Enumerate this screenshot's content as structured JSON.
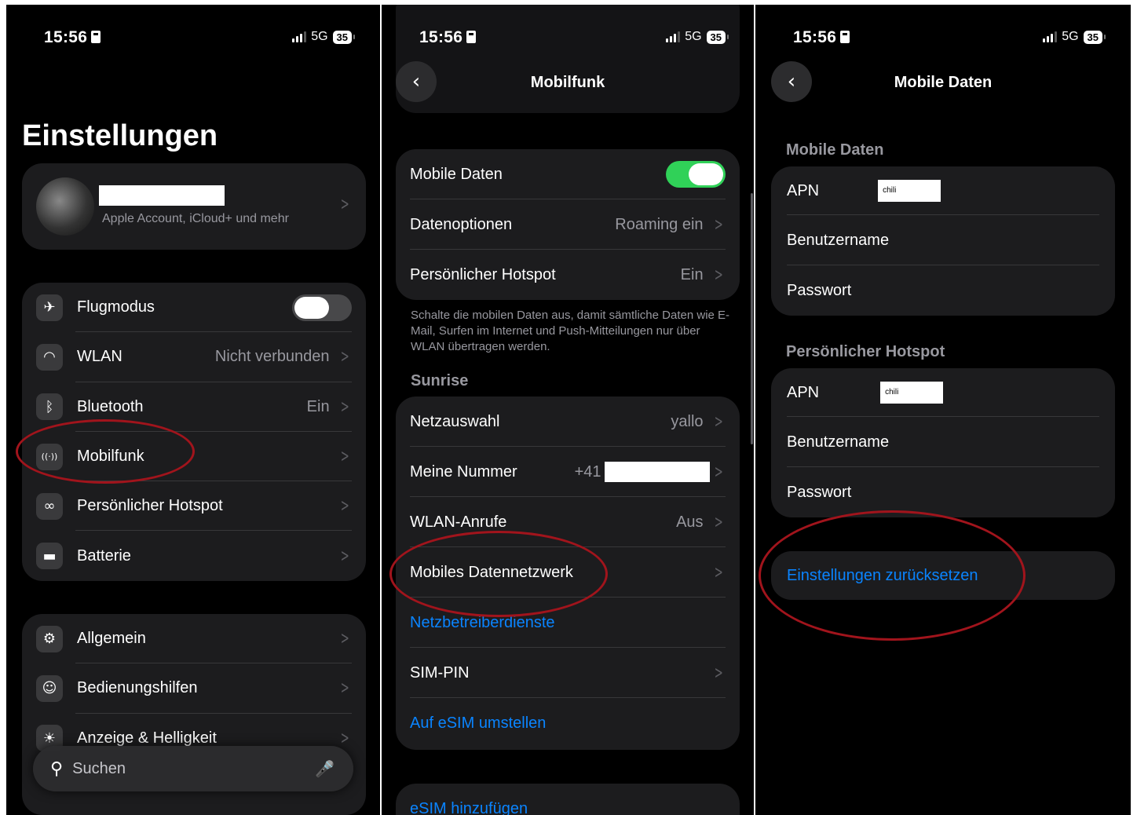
{
  "status": {
    "time": "15:56",
    "network": "5G",
    "battery": "35"
  },
  "panel1": {
    "title": "Einstellungen",
    "account_sub": "Apple Account, iCloud+ und mehr",
    "group1": [
      {
        "label": "Flugmodus",
        "icon": "airplane-icon",
        "toggle": "off"
      },
      {
        "label": "WLAN",
        "value": "Nicht verbunden",
        "icon": "wifi-icon"
      },
      {
        "label": "Bluetooth",
        "value": "Ein",
        "icon": "bluetooth-icon"
      },
      {
        "label": "Mobilfunk",
        "value": "",
        "icon": "antenna-icon"
      },
      {
        "label": "Persönlicher Hotspot",
        "value": "",
        "icon": "hotspot-icon"
      },
      {
        "label": "Batterie",
        "value": "",
        "icon": "battery-icon"
      }
    ],
    "group2": [
      {
        "label": "Allgemein",
        "icon": "gear-icon"
      },
      {
        "label": "Bedienungshilfen",
        "icon": "accessibility-icon"
      },
      {
        "label": "Anzeige & Helligkeit",
        "icon": "brightness-icon"
      }
    ],
    "search_placeholder": "Suchen"
  },
  "panel2": {
    "title": "Mobilfunk",
    "group1": {
      "mobile_data": "Mobile Daten",
      "data_options": "Datenoptionen",
      "data_options_value": "Roaming ein",
      "hotspot": "Persönlicher Hotspot",
      "hotspot_value": "Ein"
    },
    "footnote": "Schalte die mobilen Daten aus, damit sämtliche Daten wie E-Mail, Surfen im Internet und Push-Mitteilungen nur über WLAN übertragen werden.",
    "section": "Sunrise",
    "group2": {
      "network": "Netzauswahl",
      "network_value": "yallo",
      "my_number": "Meine Nummer",
      "my_number_prefix": "+41",
      "wifi_calls": "WLAN-Anrufe",
      "wifi_calls_value": "Aus",
      "mobile_data_network": "Mobiles Datennetzwerk",
      "carrier_services": "Netzbetreiberdienste",
      "sim_pin": "SIM-PIN",
      "esim_switch": "Auf eSIM umstellen"
    },
    "add_esim": "eSIM hinzufügen"
  },
  "panel3": {
    "title": "Mobile Daten",
    "section1": "Mobile Daten",
    "section2": "Persönlicher Hotspot",
    "apn": "APN",
    "apn_value": "chili",
    "username": "Benutzername",
    "password": "Passwort",
    "reset": "Einstellungen zurücksetzen"
  },
  "colors": {
    "accent": "#0a84ff",
    "toggle_on": "#30d158",
    "annotation": "#a1141c"
  }
}
